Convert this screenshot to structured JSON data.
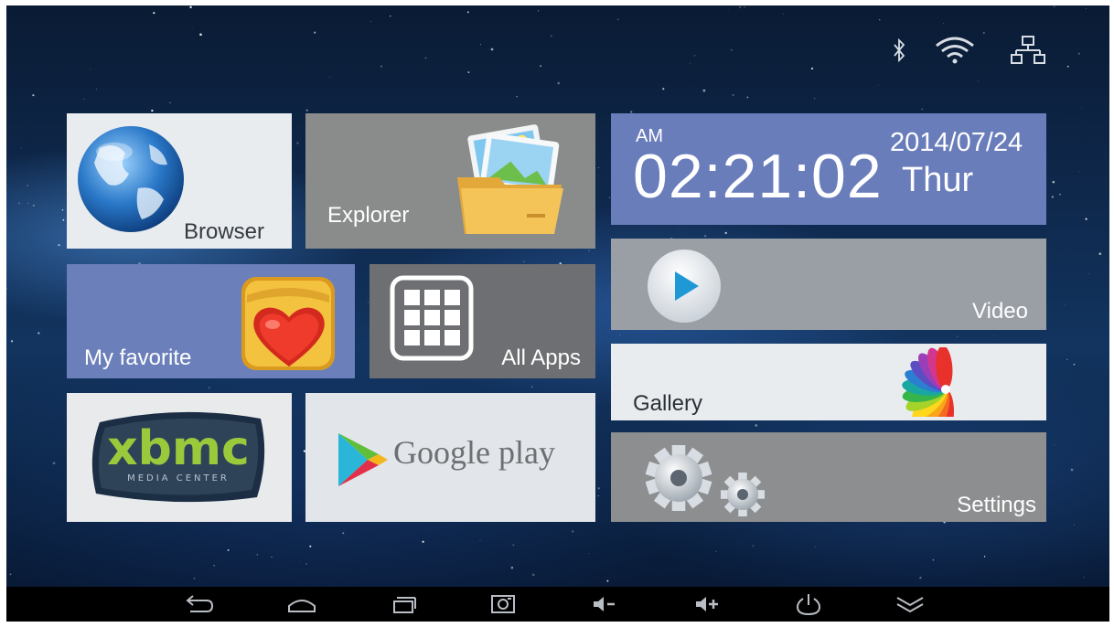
{
  "status_bar": {
    "icons": [
      "bluetooth-icon",
      "wifi-icon",
      "ethernet-icon"
    ]
  },
  "tiles": {
    "browser": {
      "label": "Browser",
      "icon": "globe-icon"
    },
    "explorer": {
      "label": "Explorer",
      "icon": "folder-photo-icon"
    },
    "favorite": {
      "label": "My favorite",
      "icon": "heart-folder-icon"
    },
    "all_apps": {
      "label": "All Apps",
      "icon": "app-grid-icon"
    },
    "xbmc": {
      "logo_text": "xbmc",
      "logo_subtext": "MEDIA CENTER",
      "icon": "xbmc-logo"
    },
    "google_play": {
      "label": "Google play",
      "icon": "google-play-icon"
    },
    "video": {
      "label": "Video",
      "icon": "play-icon"
    },
    "gallery": {
      "label": "Gallery",
      "icon": "color-petals-icon"
    },
    "settings": {
      "label": "Settings",
      "icon": "gears-icon"
    }
  },
  "clock": {
    "ampm": "AM",
    "time": "02:21:02",
    "date": "2014/07/24",
    "day": "Thur"
  },
  "navbar": {
    "buttons": [
      "back-icon",
      "home-icon",
      "recent-apps-icon",
      "screenshot-icon",
      "volume-down-icon",
      "volume-up-icon",
      "power-icon",
      "hide-bar-icon"
    ]
  },
  "colors": {
    "tile_blue": "#6b7fbb",
    "tile_gray": "#8a8c8c",
    "tile_dark": "#6e6f72",
    "tile_light": "#e9ecef",
    "navbar": "#000000"
  }
}
